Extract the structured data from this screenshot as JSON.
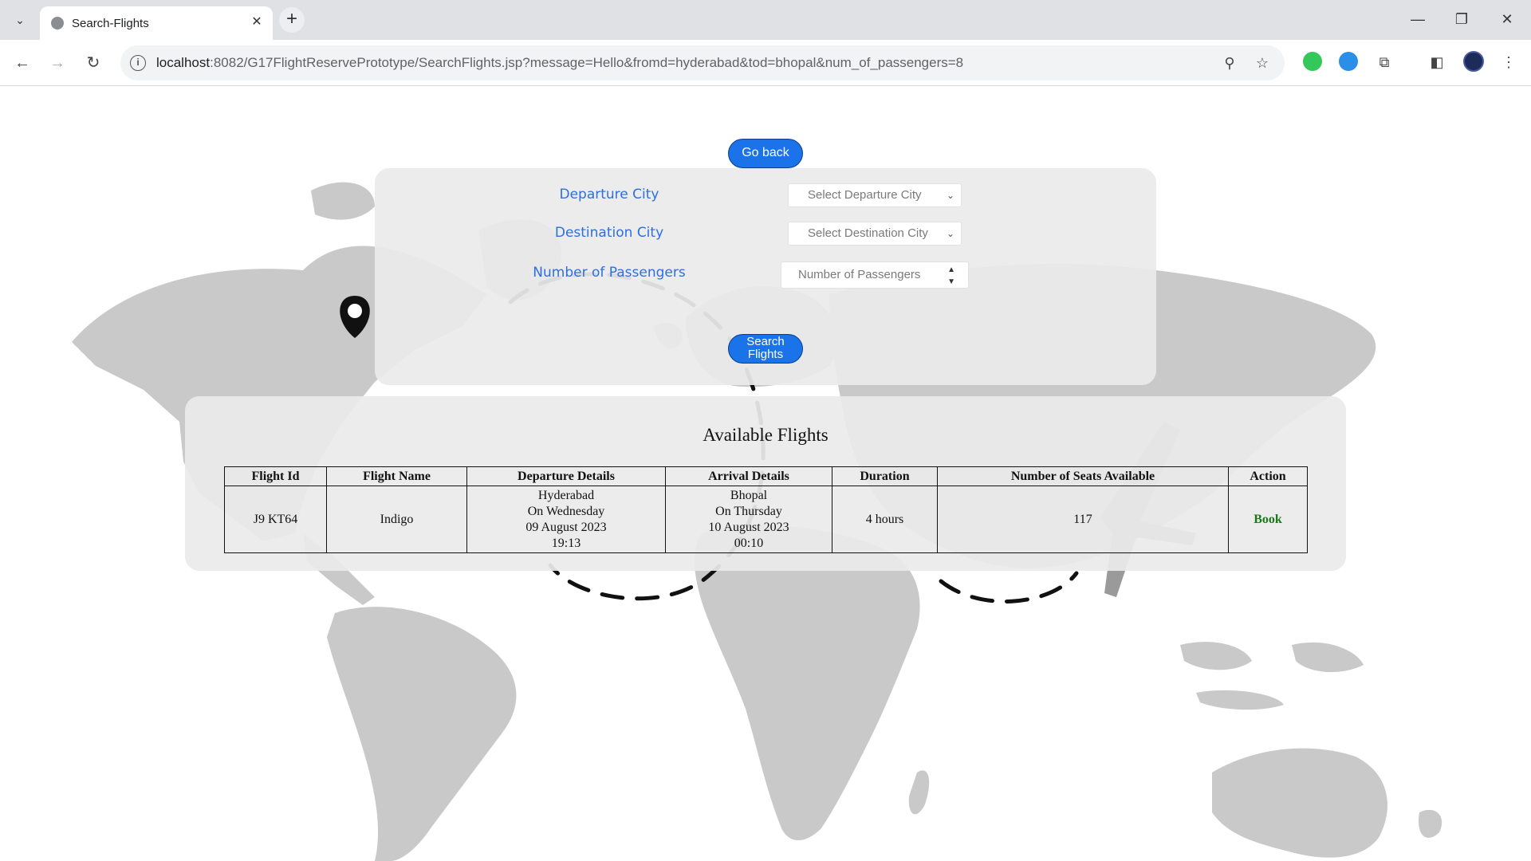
{
  "browser": {
    "tab_title": "Search-Flights",
    "url_host": "localhost",
    "url_rest": ":8082/G17FlightReservePrototype/SearchFlights.jsp?message=Hello&fromd=hyderabad&tod=bhopal&num_of_passengers=8",
    "icons": {
      "tab_list": "chevron-down-icon",
      "favicon": "globe-icon",
      "close_tab": "close-icon",
      "new_tab": "plus-icon",
      "back": "arrow-left-icon",
      "forward": "arrow-right-icon",
      "reload": "reload-icon",
      "site_info": "info-icon",
      "zoom": "zoom-icon",
      "bookmark": "star-icon",
      "extensions": "puzzle-icon",
      "side_panel": "side-panel-icon",
      "profile": "avatar-icon",
      "menu": "kebab-menu-icon"
    },
    "glyphs": {
      "tab_list": "⌄",
      "close_tab": "✕",
      "new_tab": "+",
      "minimize": "—",
      "maximize": "❐",
      "close_window": "✕",
      "back": "←",
      "forward": "→",
      "reload": "↻",
      "site_info": "i",
      "zoom": "⚲",
      "bookmark": "☆",
      "extensions": "⧉",
      "side_panel": "◧",
      "menu": "⋮"
    }
  },
  "page": {
    "go_back_label": "Go back",
    "form": {
      "departure_label": "Departure City",
      "departure_placeholder": "Select Departure City",
      "destination_label": "Destination City",
      "destination_placeholder": "Select Destination City",
      "passengers_label": "Number of Passengers",
      "passengers_placeholder": "Number of Passengers",
      "search_label_line1": "Search",
      "search_label_line2": "Flights",
      "chevron": "⌄",
      "spin_up": "▲",
      "spin_down": "▼"
    },
    "results": {
      "title": "Available Flights",
      "columns": [
        "Flight Id",
        "Flight Name",
        "Departure Details",
        "Arrival Details",
        "Duration",
        "Number of Seats Available",
        "Action"
      ],
      "rows": [
        {
          "flight_id": "J9 KT64",
          "flight_name": "Indigo",
          "departure": {
            "city": "Hyderabad",
            "day": "On Wednesday",
            "date": "09 August 2023",
            "time": "19:13"
          },
          "arrival": {
            "city": "Bhopal",
            "day": "On Thursday",
            "date": "10 August 2023",
            "time": "00:10"
          },
          "duration": "4 hours",
          "seats": "117",
          "action": "Book"
        }
      ]
    }
  },
  "colors": {
    "accent_blue": "#1a73e8",
    "label_blue": "#2d6fe0",
    "book_green": "#1a7a1a",
    "map_gray": "#c8c8c8"
  }
}
